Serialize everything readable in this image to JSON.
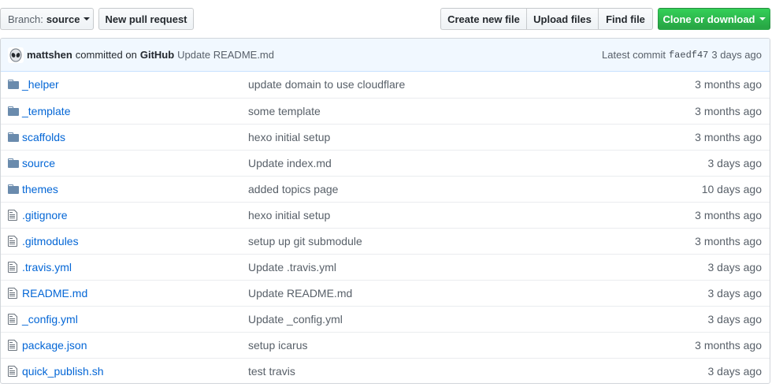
{
  "toolbar": {
    "branch_label": "Branch:",
    "branch_value": "source",
    "new_pull_request": "New pull request",
    "create_new_file": "Create new file",
    "upload_files": "Upload files",
    "find_file": "Find file",
    "clone_or_download": "Clone or download",
    "clone_color": "#28a745"
  },
  "commit": {
    "author": "mattshen",
    "committed_on": "committed on",
    "platform": "GitHub",
    "message": "Update README.md",
    "latest_commit_label": "Latest commit",
    "sha": "faedf47",
    "age": "3 days ago"
  },
  "files": [
    {
      "icon": "folder-icon",
      "name": "_helper",
      "message": "update domain to use cloudflare",
      "age": "3 months ago"
    },
    {
      "icon": "folder-icon",
      "name": "_template",
      "message": "some template",
      "age": "3 months ago"
    },
    {
      "icon": "folder-icon",
      "name": "scaffolds",
      "message": "hexo initial setup",
      "age": "3 months ago"
    },
    {
      "icon": "folder-icon",
      "name": "source",
      "message": "Update index.md",
      "age": "3 days ago"
    },
    {
      "icon": "folder-icon",
      "name": "themes",
      "message": "added topics page",
      "age": "10 days ago"
    },
    {
      "icon": "file-icon",
      "name": ".gitignore",
      "message": "hexo initial setup",
      "age": "3 months ago"
    },
    {
      "icon": "file-icon",
      "name": ".gitmodules",
      "message": "setup up git submodule",
      "age": "3 months ago"
    },
    {
      "icon": "file-icon",
      "name": ".travis.yml",
      "message": "Update .travis.yml",
      "age": "3 days ago"
    },
    {
      "icon": "file-icon",
      "name": "README.md",
      "message": "Update README.md",
      "age": "3 days ago"
    },
    {
      "icon": "file-icon",
      "name": "_config.yml",
      "message": "Update _config.yml",
      "age": "3 days ago"
    },
    {
      "icon": "file-icon",
      "name": "package.json",
      "message": "setup icarus",
      "age": "3 months ago"
    },
    {
      "icon": "file-icon",
      "name": "quick_publish.sh",
      "message": "test travis",
      "age": "3 days ago"
    }
  ]
}
